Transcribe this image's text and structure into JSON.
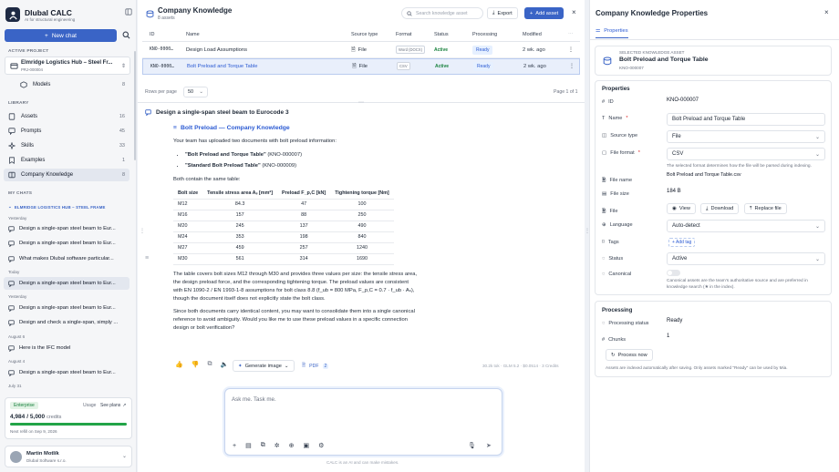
{
  "app": {
    "name": "Dlubal CALC",
    "tagline": "AI for structural engineering",
    "new_chat": "New chat",
    "footer_note": "CALC is an AI and can make mistakes."
  },
  "project": {
    "section": "ACTIVE PROJECT",
    "name": "Elmridge Logistics Hub – Steel Fr...",
    "code": "PRJ-000004",
    "models_label": "Models",
    "models_count": "8"
  },
  "library": {
    "section": "LIBRARY",
    "items": [
      {
        "label": "Assets",
        "count": "16",
        "icon": "assets-icon"
      },
      {
        "label": "Prompts",
        "count": "45",
        "icon": "prompts-icon"
      },
      {
        "label": "Skills",
        "count": "33",
        "icon": "skills-icon"
      },
      {
        "label": "Examples",
        "count": "1",
        "icon": "examples-icon"
      },
      {
        "label": "Company Knowledge",
        "count": "8",
        "icon": "knowledge-icon"
      }
    ]
  },
  "my_chats": {
    "section": "MY CHATS",
    "group": "ELMRIDGE LOGISTICS HUB – STEEL FRAME",
    "days": [
      "Yesterday",
      "Today",
      "Yesterday",
      "August 6",
      "August 4",
      "July 31"
    ],
    "items": [
      "Design a single-span steel beam to Eur...",
      "Design a single-span steel beam to Eur...",
      "What makes Dlubal software particular...",
      "Design a single-span steel beam to Eur...",
      "Design a single-span steel beam to Eur...",
      "Design and check a single-span, simply ...",
      "Here is the IFC model",
      "Design a single-span steel beam to Eur..."
    ]
  },
  "plan": {
    "name": "Enterprise",
    "usage": "Usage",
    "see_plans": "See plans",
    "credits_used": "4,984",
    "credits_total": "/ 5,000",
    "credits_unit": "credits",
    "credits_fraction": 0.997,
    "refill": "Next refill on Sep 9, 2026"
  },
  "user": {
    "name": "Martin Motlík",
    "company": "Dlubal Software s.r.o."
  },
  "knowledge": {
    "title": "Company Knowledge",
    "subtitle": "8 assets",
    "search_placeholder": "Search knowledge asset",
    "export": "Export",
    "add_asset": "Add asset",
    "columns": [
      "ID",
      "Name",
      "Source type",
      "Format",
      "Status",
      "Processing",
      "Modified"
    ],
    "rows": [
      {
        "id": "KNO-0000…",
        "name": "Design Load Assumptions",
        "source": "File",
        "format": "Word (DOCX)",
        "status": "Active",
        "processing": "Ready",
        "modified": "2 wk. ago"
      },
      {
        "id": "KNO-0000…",
        "name": "Bolt Preload and Torque Table",
        "source": "File",
        "format": "CSV",
        "status": "Active",
        "processing": "Ready",
        "modified": "2 wk. ago"
      }
    ],
    "rows_per_page_label": "Rows per page",
    "rows_per_page": "50",
    "page_info": "Page 1 of 1"
  },
  "chat": {
    "title": "Design a single-span steel beam to Eurocode 3",
    "source_title": "Bolt Preload — Company Knowledge",
    "intro": "Your team has uploaded two documents with bolt preload information:",
    "bullets": [
      {
        "name": "\"Bolt Preload and Torque Table\"",
        "id": "(KNO-000007)"
      },
      {
        "name": "\"Standard Bolt Preload Table\"",
        "id": "(KNO-000009)"
      }
    ],
    "same_table": "Both contain the same table:",
    "table_headers": [
      "Bolt size",
      "Tensile stress area Aₛ [mm²]",
      "Preload F_p,C [kN]",
      "Tightening torque [Nm]"
    ],
    "table_rows": [
      [
        "M12",
        "84.3",
        "47",
        "100"
      ],
      [
        "M16",
        "157",
        "88",
        "250"
      ],
      [
        "M20",
        "245",
        "137",
        "490"
      ],
      [
        "M24",
        "353",
        "198",
        "840"
      ],
      [
        "M27",
        "459",
        "257",
        "1240"
      ],
      [
        "M30",
        "561",
        "314",
        "1690"
      ]
    ],
    "para1": "The table covers bolt sizes M12 through M30 and provides three values per size: the tensile stress area, the design preload force, and the corresponding tightening torque. The preload values are consistent with EN 1090-2 / EN 1993-1-8 assumptions for bolt class 8.8 (f_ub = 800 MPa, F_p,C = 0.7 · f_ub · Aₛ), though the document itself does not explicitly state the bolt class.",
    "para2": "Since both documents carry identical content, you may want to consolidate them into a single canonical reference to avoid ambiguity. Would you like me to use these preload values in a specific connection design or bolt verification?",
    "generate_image": "Generate image",
    "pdf": "PDF",
    "pdf_count": "2",
    "meta": "30.2k tok · GLM 5.2 · $0.0514 · 3 Credits",
    "composer_placeholder": "Ask me. Task me."
  },
  "properties": {
    "panel_title": "Company Knowledge Properties",
    "tab": "Properties",
    "selected_label": "SELECTED KNOWLEDGE ASSET",
    "selected_name": "Bolt Preload and Torque Table",
    "selected_id": "KNO-000007",
    "section": "Properties",
    "id_label": "ID",
    "id_value": "KNO-000007",
    "name_label": "Name",
    "name_value": "Bolt Preload and Torque Table",
    "source_label": "Source type",
    "source_value": "File",
    "format_label": "File format",
    "format_value": "CSV",
    "format_hint": "The selected format determines how the file will be parsed during indexing.",
    "filename_label": "File name",
    "filename_value": "Bolt Preload and Torque Table.csv",
    "filesize_label": "File size",
    "filesize_value": "184 B",
    "file_label": "File",
    "view": "View",
    "download": "Download",
    "replace": "Replace file",
    "language_label": "Language",
    "language_value": "Auto-detect",
    "tags_label": "Tags",
    "add_tag": "+ Add tag",
    "status_label": "Status",
    "status_value": "Active",
    "canonical_label": "Canonical",
    "canonical_hint": "Canonical assets are the team's authoritative source and are preferred in knowledge search (★ in the index).",
    "processing_section": "Processing",
    "proc_status_label": "Processing status",
    "proc_status_value": "Ready",
    "chunks_label": "Chunks",
    "chunks_value": "1",
    "process_now": "Process now",
    "index_hint": "Assets are indexed automatically after saving. Only assets marked \"Ready\" can be used by Mia."
  },
  "colors": {
    "accent": "#3a64c6",
    "active_green": "#16803c",
    "progress": "#22a447"
  }
}
